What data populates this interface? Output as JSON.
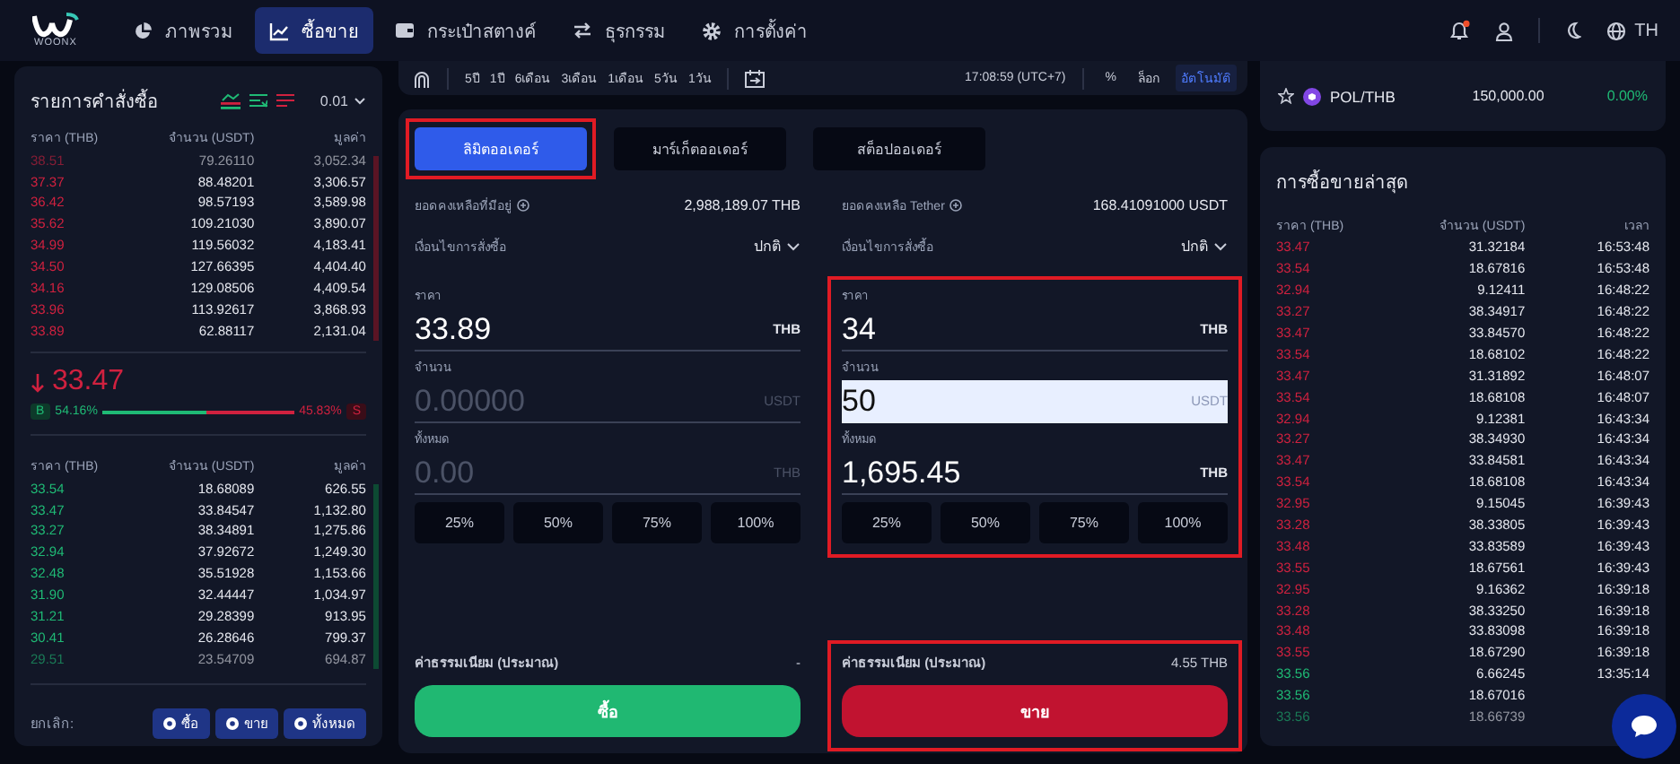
{
  "nav": {
    "logo_text": "WOONX",
    "items": [
      {
        "label": "ภาพรวม",
        "selected": false
      },
      {
        "label": "ซื้อขาย",
        "selected": true
      },
      {
        "label": "กระเป๋าสตางค์",
        "selected": false
      },
      {
        "label": "ธุรกรรม",
        "selected": false
      },
      {
        "label": "การตั้งค่า",
        "selected": false
      }
    ],
    "notification_dot": true,
    "language": "TH"
  },
  "order_book": {
    "title": "รายการคำสั่งซื้อ",
    "precision": "0.01",
    "columns": [
      "ราคา (THB)",
      "จำนวน (USDT)",
      "มูลค่า"
    ],
    "asks": [
      {
        "price": "38.51",
        "amount": "79.26110",
        "value": "3,052.34",
        "faded": true
      },
      {
        "price": "37.37",
        "amount": "88.48201",
        "value": "3,306.57",
        "faded": false
      },
      {
        "price": "36.42",
        "amount": "98.57193",
        "value": "3,589.98",
        "faded": false
      },
      {
        "price": "35.62",
        "amount": "109.21030",
        "value": "3,890.07",
        "faded": false
      },
      {
        "price": "34.99",
        "amount": "119.56032",
        "value": "4,183.41",
        "faded": false
      },
      {
        "price": "34.50",
        "amount": "127.66395",
        "value": "4,404.40",
        "faded": false
      },
      {
        "price": "34.16",
        "amount": "129.08506",
        "value": "4,409.54",
        "faded": false
      },
      {
        "price": "33.96",
        "amount": "113.92617",
        "value": "3,868.93",
        "faded": false
      },
      {
        "price": "33.89",
        "amount": "62.88117",
        "value": "2,131.04",
        "faded": false
      }
    ],
    "last_price": "33.47",
    "buy_label": "B",
    "buy_share": "54.16%",
    "sell_share": "45.83%",
    "sell_label": "S",
    "level": 0.5416,
    "bid_columns": [
      "ราคา (THB)",
      "จำนวน (USDT)",
      "มูลค่า"
    ],
    "bids": [
      {
        "price": "33.54",
        "amount": "18.68089",
        "value": "626.55",
        "faded": false
      },
      {
        "price": "33.47",
        "amount": "33.84547",
        "value": "1,132.80",
        "faded": false
      },
      {
        "price": "33.27",
        "amount": "38.34891",
        "value": "1,275.86",
        "faded": false
      },
      {
        "price": "32.94",
        "amount": "37.92672",
        "value": "1,249.30",
        "faded": false
      },
      {
        "price": "32.48",
        "amount": "35.51928",
        "value": "1,153.66",
        "faded": false
      },
      {
        "price": "31.90",
        "amount": "32.44447",
        "value": "1,034.97",
        "faded": false
      },
      {
        "price": "31.21",
        "amount": "29.28399",
        "value": "913.95",
        "faded": false
      },
      {
        "price": "30.41",
        "amount": "26.28646",
        "value": "799.37",
        "faded": false
      },
      {
        "price": "29.51",
        "amount": "23.54709",
        "value": "694.87",
        "faded": true
      }
    ],
    "cancel_label": "ยกเลิก:",
    "cancel_buttons": [
      "ซื้อ",
      "ขาย",
      "ทั้งหมด"
    ]
  },
  "chart_toolbar": {
    "periods": [
      "5ปี",
      "1ปี",
      "6เดือน",
      "3เดือน",
      "1เดือน",
      "5วัน",
      "1วัน"
    ],
    "time": "17:08:59 (UTC+7)",
    "options": [
      {
        "label": "%",
        "selected": false
      },
      {
        "label": "ล็อก",
        "selected": false
      },
      {
        "label": "อัตโนมัติ",
        "selected": true
      }
    ]
  },
  "order_form": {
    "tabs": [
      {
        "label": "ลิมิตออเดอร์",
        "selected": true,
        "highlighted": true
      },
      {
        "label": "มาร์เก็ตออเดอร์",
        "selected": false,
        "highlighted": false
      },
      {
        "label": "สต็อปออเดอร์",
        "selected": false,
        "highlighted": false
      }
    ],
    "sides": [
      {
        "kind": "buy",
        "balance_label": "ยอดคงเหลือที่มีอยู่",
        "balance": "2,988,189.07 THB",
        "condition_label": "เงื่อนไขการสั่งซื้อ",
        "condition": "ปกติ",
        "fields": [
          {
            "label": "ราคา",
            "value": "33.89",
            "unit": "THB",
            "focused": false
          },
          {
            "label": "จำนวน",
            "placeholder": "0.00000",
            "unit": "USDT",
            "focused": false
          },
          {
            "label": "ทั้งหมด",
            "placeholder": "0.00",
            "unit": "THB",
            "focused": false
          }
        ],
        "fields_highlighted": false,
        "percents": [
          "25%",
          "50%",
          "75%",
          "100%"
        ],
        "fee_label": "ค่าธรรมเนียม (ประมาณ)",
        "fee": "-",
        "action": "ซื้อ",
        "action_highlighted": false
      },
      {
        "kind": "sell",
        "balance_label": "ยอดคงเหลือ Tether",
        "balance": "168.41091000 USDT",
        "condition_label": "เงื่อนไขการสั่งซื้อ",
        "condition": "ปกติ",
        "fields": [
          {
            "label": "ราคา",
            "value": "34",
            "unit": "THB",
            "focused": false
          },
          {
            "label": "จำนวน",
            "value": "50",
            "unit": "USDT",
            "focused": true
          },
          {
            "label": "ทั้งหมด",
            "value": "1,695.45",
            "unit": "THB",
            "focused": false
          }
        ],
        "fields_highlighted": true,
        "percents": [
          "25%",
          "50%",
          "75%",
          "100%"
        ],
        "fee_label": "ค่าธรรมเนียม (ประมาณ)",
        "fee": "4.55 THB",
        "action": "ขาย",
        "action_highlighted": true
      }
    ]
  },
  "market": {
    "pair": "POL/THB",
    "price": "150,000.00",
    "change": "0.00%",
    "favorite": false
  },
  "trades": {
    "title": "การซื้อขายล่าสุด",
    "columns": [
      "ราคา (THB)",
      "จำนวน (USDT)",
      "เวลา"
    ],
    "rows": [
      {
        "price": "33.47",
        "amount": "31.32184",
        "time": "16:53:48",
        "kind": "sell",
        "faded": false
      },
      {
        "price": "33.54",
        "amount": "18.67816",
        "time": "16:53:48",
        "kind": "sell",
        "faded": false
      },
      {
        "price": "32.94",
        "amount": "9.12411",
        "time": "16:48:22",
        "kind": "sell",
        "faded": false
      },
      {
        "price": "33.27",
        "amount": "38.34917",
        "time": "16:48:22",
        "kind": "sell",
        "faded": false
      },
      {
        "price": "33.47",
        "amount": "33.84570",
        "time": "16:48:22",
        "kind": "sell",
        "faded": false
      },
      {
        "price": "33.54",
        "amount": "18.68102",
        "time": "16:48:22",
        "kind": "sell",
        "faded": false
      },
      {
        "price": "33.47",
        "amount": "31.31892",
        "time": "16:48:07",
        "kind": "sell",
        "faded": false
      },
      {
        "price": "33.54",
        "amount": "18.68108",
        "time": "16:48:07",
        "kind": "sell",
        "faded": false
      },
      {
        "price": "32.94",
        "amount": "9.12381",
        "time": "16:43:34",
        "kind": "sell",
        "faded": false
      },
      {
        "price": "33.27",
        "amount": "38.34930",
        "time": "16:43:34",
        "kind": "sell",
        "faded": false
      },
      {
        "price": "33.47",
        "amount": "33.84581",
        "time": "16:43:34",
        "kind": "sell",
        "faded": false
      },
      {
        "price": "33.54",
        "amount": "18.68108",
        "time": "16:43:34",
        "kind": "sell",
        "faded": false
      },
      {
        "price": "32.95",
        "amount": "9.15045",
        "time": "16:39:43",
        "kind": "sell",
        "faded": false
      },
      {
        "price": "33.28",
        "amount": "38.33805",
        "time": "16:39:43",
        "kind": "sell",
        "faded": false
      },
      {
        "price": "33.48",
        "amount": "33.83589",
        "time": "16:39:43",
        "kind": "sell",
        "faded": false
      },
      {
        "price": "33.55",
        "amount": "18.67561",
        "time": "16:39:43",
        "kind": "sell",
        "faded": false
      },
      {
        "price": "32.95",
        "amount": "9.16362",
        "time": "16:39:18",
        "kind": "sell",
        "faded": false
      },
      {
        "price": "33.28",
        "amount": "38.33250",
        "time": "16:39:18",
        "kind": "sell",
        "faded": false
      },
      {
        "price": "33.48",
        "amount": "33.83098",
        "time": "16:39:18",
        "kind": "sell",
        "faded": false
      },
      {
        "price": "33.55",
        "amount": "18.67290",
        "time": "16:39:18",
        "kind": "sell",
        "faded": false
      },
      {
        "price": "33.56",
        "amount": "6.66245",
        "time": "13:35:14",
        "kind": "buy",
        "faded": false
      },
      {
        "price": "33.56",
        "amount": "18.67016",
        "kind": "buy",
        "faded": false
      },
      {
        "price": "33.56",
        "amount": "18.66739",
        "kind": "buy",
        "faded": true
      }
    ]
  }
}
